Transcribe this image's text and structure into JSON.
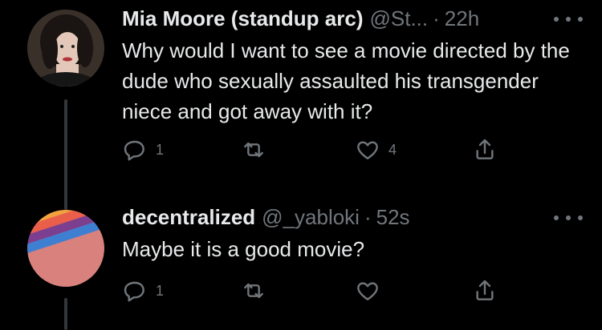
{
  "tweets": [
    {
      "name": "Mia Moore (standup arc)",
      "handle": "@St...",
      "separator": "·",
      "time": "22h",
      "text": "Why would I want to see a movie directed by the dude who sexually assaulted his transgender niece and got away with it?",
      "replies": "1",
      "retweets": "",
      "likes": "4"
    },
    {
      "name": "decentralized",
      "handle": "@_yabloki",
      "separator": "·",
      "time": "52s",
      "text": "Maybe it is a good movie?",
      "replies": "1",
      "retweets": "",
      "likes": ""
    }
  ],
  "colors": {
    "background": "#000000",
    "text": "#e7e9ea",
    "secondary": "#71767b",
    "thread_line": "#333639"
  },
  "icons": [
    "reply-icon",
    "retweet-icon",
    "like-icon",
    "share-icon",
    "more-icon"
  ]
}
